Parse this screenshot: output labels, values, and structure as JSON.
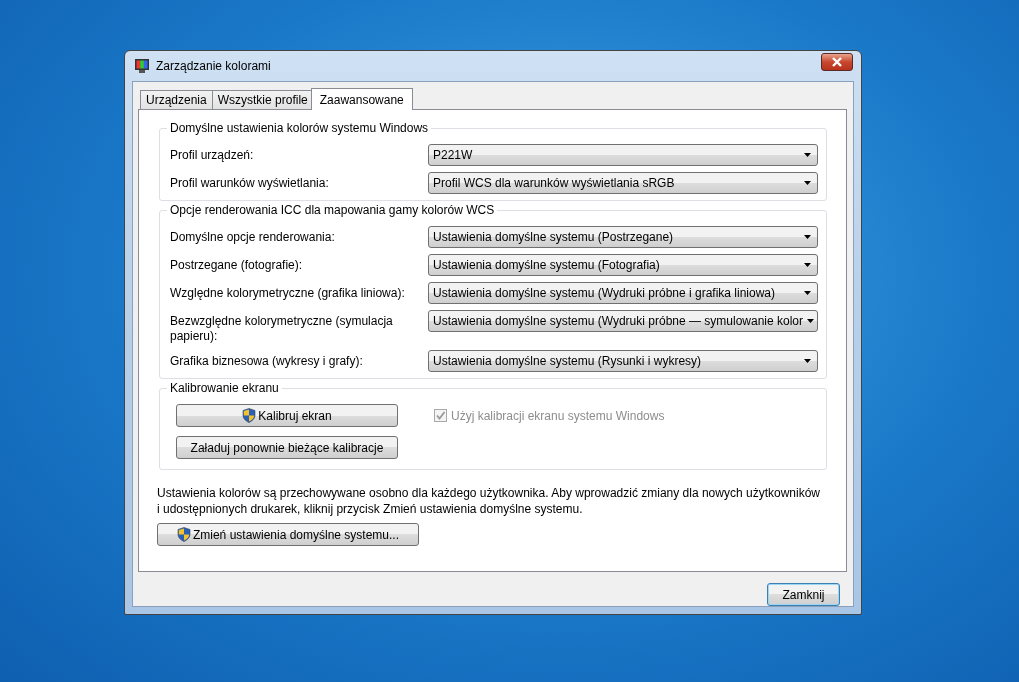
{
  "window": {
    "title": "Zarządzanie kolorami"
  },
  "tabs": [
    {
      "label": "Urządzenia",
      "selected": false
    },
    {
      "label": "Wszystkie profile",
      "selected": false
    },
    {
      "label": "Zaawansowane",
      "selected": true
    }
  ],
  "groups": [
    {
      "title": "Domyślne ustawienia kolorów systemu Windows",
      "kind": "dropdowns",
      "rows": [
        {
          "label": "Profil urządzeń:",
          "value": "P221W"
        },
        {
          "label": "Profil warunków wyświetlania:",
          "value": "Profil WCS dla warunków wyświetlania sRGB"
        }
      ]
    },
    {
      "title": "Opcje renderowania ICC dla mapowania gamy kolorów WCS",
      "kind": "dropdowns",
      "rows": [
        {
          "label": "Domyślne opcje renderowania:",
          "value": "Ustawienia domyślne systemu (Postrzegane)"
        },
        {
          "label": "Postrzegane (fotografie):",
          "value": "Ustawienia domyślne systemu (Fotografia)"
        },
        {
          "label": "Względne kolorymetryczne (grafika liniowa):",
          "value": "Ustawienia domyślne systemu (Wydruki próbne i grafika liniowa)"
        },
        {
          "label": "Bezwzględne kolorymetryczne (symulacja papieru):",
          "value": "Ustawienia domyślne systemu (Wydruki próbne — symulowanie kolor"
        },
        {
          "label": "Grafika biznesowa (wykresy i grafy):",
          "value": "Ustawienia domyślne systemu (Rysunki i wykresy)"
        }
      ]
    },
    {
      "title": "Kalibrowanie ekranu",
      "kind": "calibration",
      "buttons": [
        {
          "label": "Kalibruj ekran",
          "shield": true
        },
        {
          "label": "Załaduj ponownie bieżące kalibracje",
          "shield": false
        }
      ],
      "checkbox": {
        "label": "Użyj kalibracji ekranu systemu Windows",
        "checked": true,
        "disabled": true
      }
    }
  ],
  "note": "Ustawienia kolorów są przechowywane osobno dla każdego użytkownika. Aby wprowadzić zmiany dla nowych użytkowników i udostępnionych drukarek, kliknij przycisk Zmień ustawienia domyślne systemu.",
  "change_button": {
    "label": "Zmień ustawienia domyślne systemu...",
    "shield": true
  },
  "close_button": "Zamknij"
}
